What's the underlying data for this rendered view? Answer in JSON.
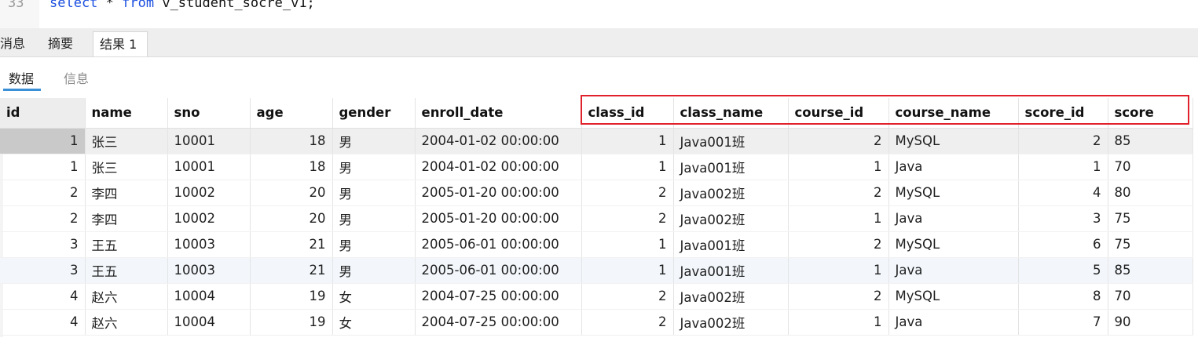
{
  "editor": {
    "line_number": "33",
    "code_keyword_select": "select",
    "code_middle": " * ",
    "code_keyword_from": "from",
    "code_rest": " v_student_socre_v1;"
  },
  "tabs": [
    {
      "label": "消息"
    },
    {
      "label": "摘要"
    },
    {
      "label": "结果 1"
    }
  ],
  "subtabs": [
    {
      "label": "数据"
    },
    {
      "label": "信息"
    }
  ],
  "table": {
    "columns": [
      "id",
      "name",
      "sno",
      "age",
      "gender",
      "enroll_date",
      "class_id",
      "class_name",
      "course_id",
      "course_name",
      "score_id",
      "score"
    ],
    "rows": [
      [
        "1",
        "张三",
        "10001",
        "18",
        "男",
        "2004-01-02 00:00:00",
        "1",
        "Java001班",
        "2",
        "MySQL",
        "2",
        "85"
      ],
      [
        "1",
        "张三",
        "10001",
        "18",
        "男",
        "2004-01-02 00:00:00",
        "1",
        "Java001班",
        "1",
        "Java",
        "1",
        "70"
      ],
      [
        "2",
        "李四",
        "10002",
        "20",
        "男",
        "2005-01-20 00:00:00",
        "2",
        "Java002班",
        "2",
        "MySQL",
        "4",
        "80"
      ],
      [
        "2",
        "李四",
        "10002",
        "20",
        "男",
        "2005-01-20 00:00:00",
        "2",
        "Java002班",
        "1",
        "Java",
        "3",
        "75"
      ],
      [
        "3",
        "王五",
        "10003",
        "21",
        "男",
        "2005-06-01 00:00:00",
        "1",
        "Java001班",
        "2",
        "MySQL",
        "6",
        "75"
      ],
      [
        "3",
        "王五",
        "10003",
        "21",
        "男",
        "2005-06-01 00:00:00",
        "1",
        "Java001班",
        "1",
        "Java",
        "5",
        "85"
      ],
      [
        "4",
        "赵六",
        "10004",
        "19",
        "女",
        "2004-07-25 00:00:00",
        "2",
        "Java002班",
        "2",
        "MySQL",
        "8",
        "70"
      ],
      [
        "4",
        "赵六",
        "10004",
        "19",
        "女",
        "2004-07-25 00:00:00",
        "2",
        "Java002班",
        "1",
        "Java",
        "7",
        "90"
      ]
    ]
  },
  "colors": {
    "highlight_border": "#e0202a",
    "keyword": "#1b4fe0",
    "subtab_underline": "#3a8fd6"
  }
}
